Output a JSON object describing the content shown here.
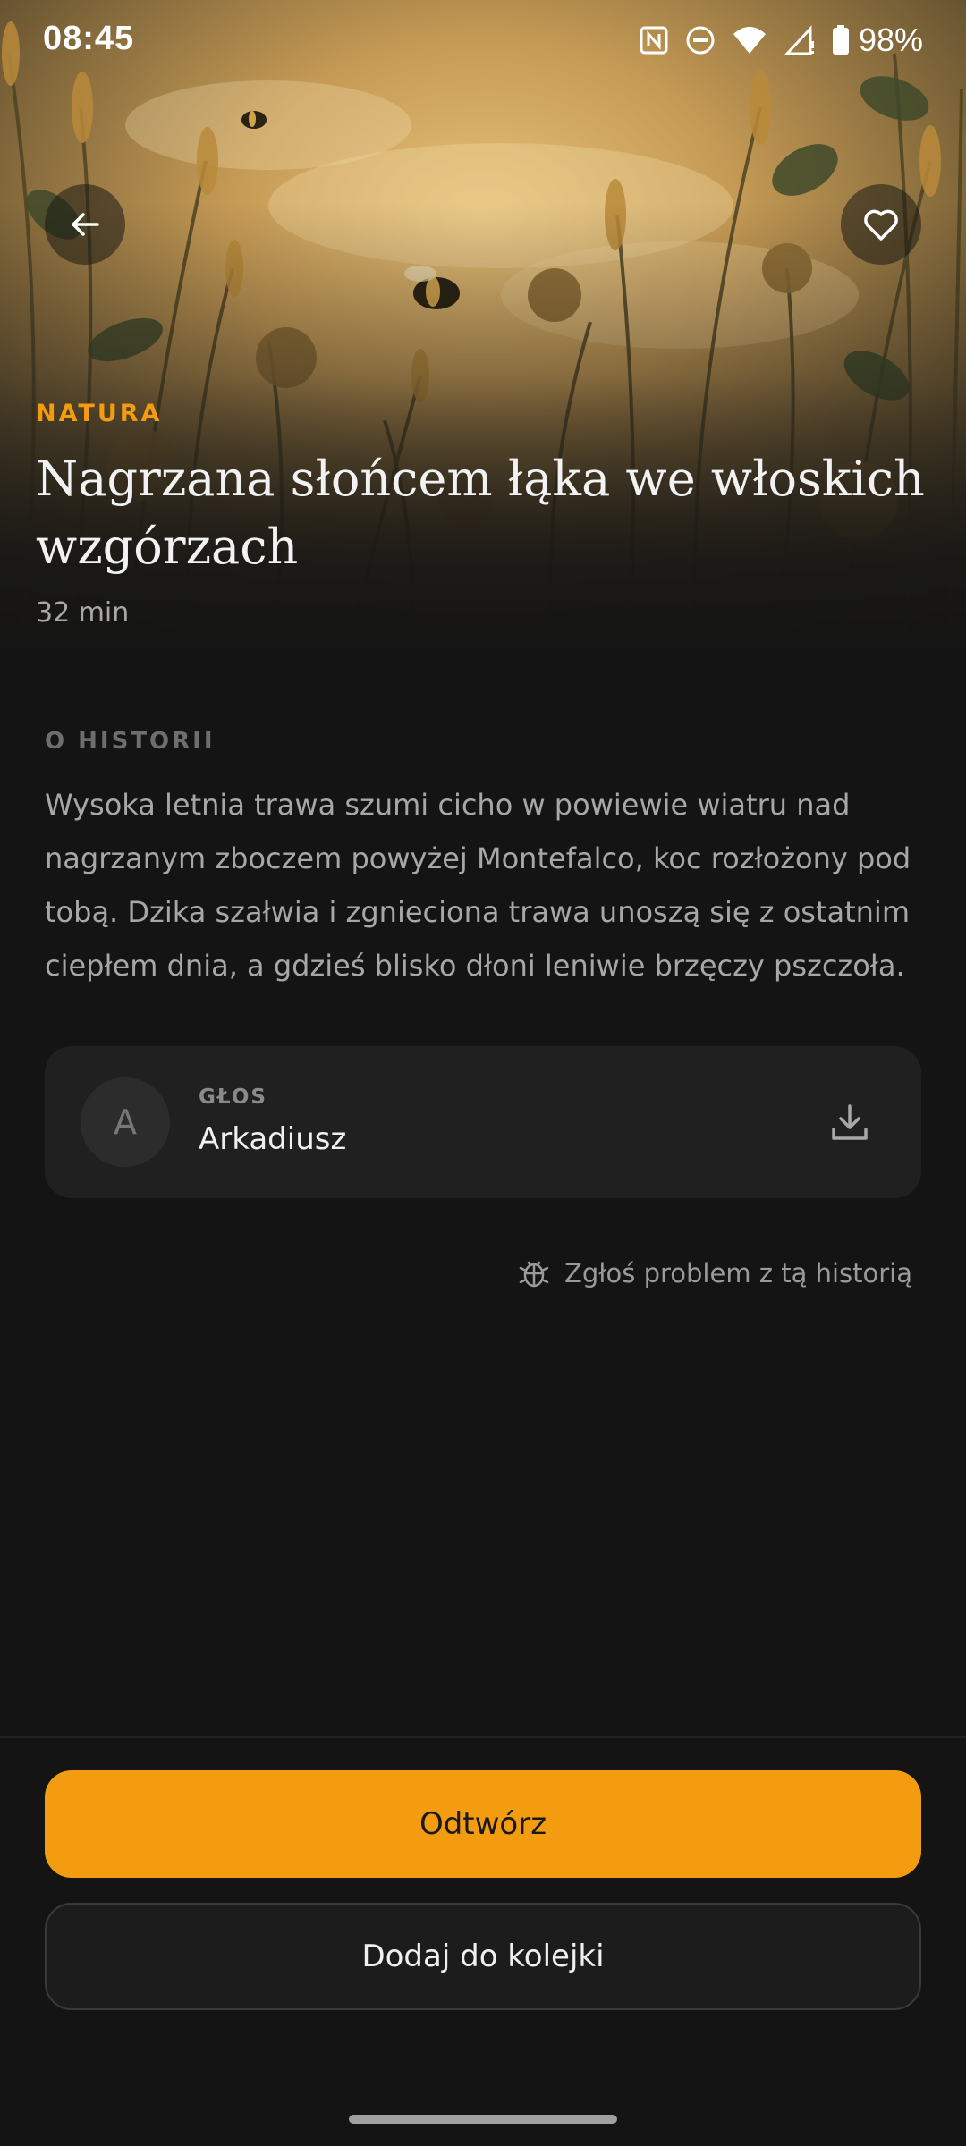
{
  "status_bar": {
    "time": "08:45",
    "battery": "98%",
    "icons": [
      "nfc-icon",
      "dnd-icon",
      "wifi-icon",
      "signal-icon",
      "battery-icon"
    ]
  },
  "hero": {
    "image": "meadow-with-bees-illustration",
    "category": "NATURA",
    "title": "Nagrzana słońcem łąka we włoskich wzgórzach",
    "duration": "32 min",
    "back_icon": "arrow-left-icon",
    "favorite_icon": "heart-outline-icon"
  },
  "about": {
    "label": "O HISTORII",
    "description": "Wysoka letnia trawa szumi cicho w powiewie wiatru nad nagrzanym zboczem powyżej Montefalco, koc rozłożony pod tobą. Dzika szałwia i zgnieciona trawa unoszą się z ostatnim ciepłem dnia, a gdzieś blisko dłoni leniwie brzęczy pszczoła."
  },
  "voice": {
    "label": "GŁOS",
    "name": "Arkadiusz",
    "avatar_letter": "A",
    "download_icon": "download-icon"
  },
  "report": {
    "label": "Zgłoś problem z tą historią",
    "icon": "bug-icon"
  },
  "actions": {
    "play_label": "Odtwórz",
    "queue_label": "Dodaj do kolejki"
  },
  "colors": {
    "accent": "#f39c12",
    "background": "#141414",
    "card": "#202020"
  }
}
